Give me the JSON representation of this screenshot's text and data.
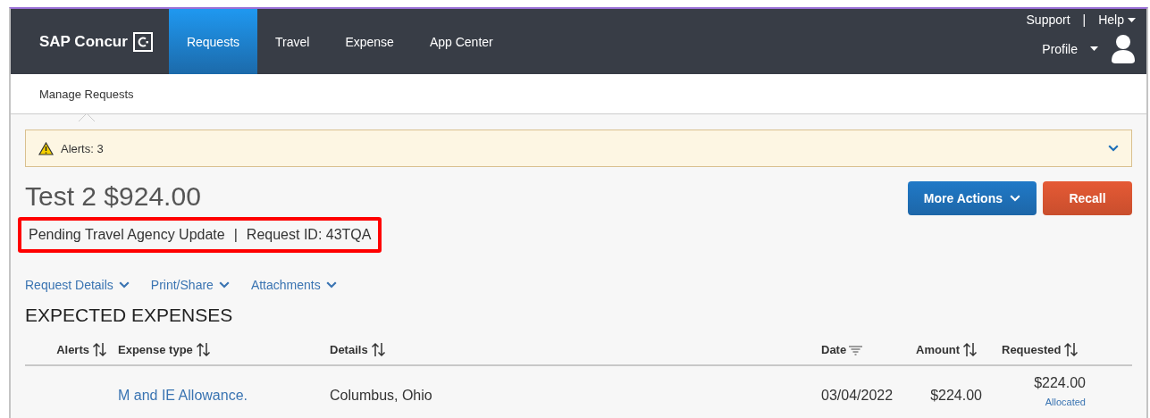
{
  "brand": {
    "name": "SAP Concur"
  },
  "nav_tabs": [
    {
      "label": "Requests",
      "selected": true
    },
    {
      "label": "Travel",
      "selected": false
    },
    {
      "label": "Expense",
      "selected": false
    },
    {
      "label": "App Center",
      "selected": false
    }
  ],
  "utility_links": {
    "support": "Support",
    "separator": "|",
    "help": "Help",
    "profile": "Profile"
  },
  "sub_nav": [
    {
      "label": "Manage Requests",
      "selected": true
    }
  ],
  "alert_bar": {
    "text": "Alerts: 3",
    "expanded": false
  },
  "request": {
    "title": "Test 2 $924.00",
    "status": "Pending Travel Agency Update",
    "separator": "|",
    "request_id": "Request ID: 43TQA"
  },
  "buttons": [
    {
      "label": "More Actions",
      "kind": "menu"
    },
    {
      "label": "Recall",
      "kind": "danger"
    }
  ],
  "section_links": [
    "Request Details",
    "Print/Share",
    "Attachments"
  ],
  "section_title": "EXPECTED EXPENSES",
  "table": {
    "columns": [
      {
        "label": "Alerts",
        "kind": "sort"
      },
      {
        "label": "Expense type",
        "kind": "sort"
      },
      {
        "label": "Details",
        "kind": "sort"
      },
      {
        "label": "Date",
        "kind": "filter"
      },
      {
        "label": "Amount",
        "kind": "sort"
      },
      {
        "label": "Requested",
        "kind": "sort"
      }
    ],
    "rows": [
      {
        "expense_type": "M and IE Allowance.",
        "details": "Columbus, Ohio",
        "date": "03/04/2022",
        "amount": "$224.00",
        "requested": "$224.00",
        "requested_note": "Allocated"
      }
    ]
  }
}
